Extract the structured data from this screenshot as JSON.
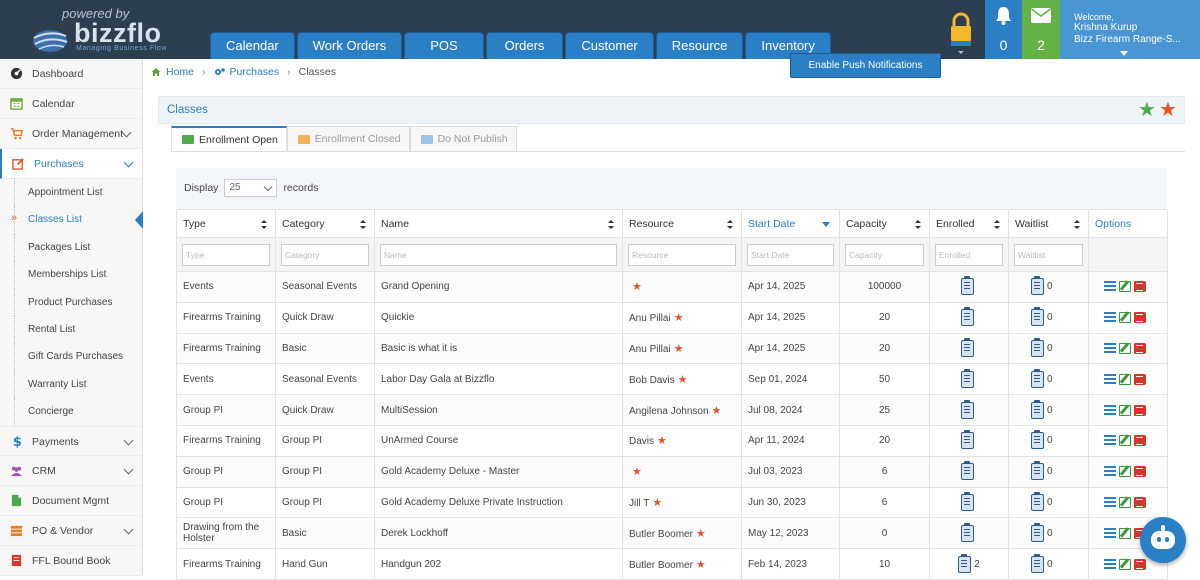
{
  "brand": {
    "powered_by": "powered by",
    "name": "bizzflo",
    "tagline": "Managing Business Flow"
  },
  "nav": [
    "Calendar",
    "Work Orders",
    "POS",
    "Orders",
    "Customer",
    "Resource",
    "Inventory"
  ],
  "header": {
    "bell_count": "0",
    "mail_count": "2",
    "welcome": "Welcome,",
    "user_name": "Krishna Kurup",
    "store": "Bizz Firearm Range-S..."
  },
  "push_button": "Enable Push Notifications",
  "sidebar": {
    "items": [
      {
        "label": "Dashboard",
        "icon": "dashboard-icon"
      },
      {
        "label": "Calendar",
        "icon": "calendar-icon"
      },
      {
        "label": "Order Management",
        "icon": "cart-icon"
      },
      {
        "label": "Purchases",
        "icon": "edit-icon"
      }
    ],
    "sub_items": [
      "Appointment List",
      "Classes List",
      "Packages List",
      "Memberships List",
      "Product Purchases",
      "Rental List",
      "Gift Cards Purchases",
      "Warranty List",
      "Concierge"
    ],
    "lower_items": [
      {
        "label": "Payments",
        "icon": "dollar-icon"
      },
      {
        "label": "CRM",
        "icon": "users-icon"
      },
      {
        "label": "Document Mgmt",
        "icon": "document-icon"
      },
      {
        "label": "PO & Vendor",
        "icon": "vendor-icon"
      },
      {
        "label": "FFL Bound Book",
        "icon": "book-icon"
      }
    ]
  },
  "breadcrumb": {
    "home": "Home",
    "purchases": "Purchases",
    "current": "Classes"
  },
  "page_title": "Classes",
  "tabs": [
    "Enrollment Open",
    "Enrollment Closed",
    "Do Not Publish"
  ],
  "display": {
    "label": "Display",
    "value": "25",
    "suffix": "records"
  },
  "columns": [
    "Type",
    "Category",
    "Name",
    "Resource",
    "Start Date",
    "Capacity",
    "Enrolled",
    "Waitlist",
    "Options"
  ],
  "filters": [
    "Type",
    "Category",
    "Name",
    "Resource",
    "Start Date",
    "Capacity",
    "Enrolled",
    "Waitlist"
  ],
  "rows": [
    {
      "type": "Events",
      "category": "Seasonal Events",
      "name": "Grand Opening",
      "resource": "",
      "start": "Apr 14, 2025",
      "capacity": "100000",
      "enrolled": "",
      "waitlist": "0"
    },
    {
      "type": "Firearms Training",
      "category": "Quick Draw",
      "name": "Quickie",
      "resource": "Anu Pillai",
      "start": "Apr 14, 2025",
      "capacity": "20",
      "enrolled": "",
      "waitlist": "0"
    },
    {
      "type": "Firearms Training",
      "category": "Basic",
      "name": "Basic is what it is",
      "resource": "Anu Pillai",
      "start": "Apr 14, 2025",
      "capacity": "20",
      "enrolled": "",
      "waitlist": "0"
    },
    {
      "type": "Events",
      "category": "Seasonal Events",
      "name": "Labor Day Gala at Bizzflo",
      "resource": "Bob Davis",
      "start": "Sep 01, 2024",
      "capacity": "50",
      "enrolled": "",
      "waitlist": "0"
    },
    {
      "type": "Group PI",
      "category": "Quick Draw",
      "name": "MultiSession",
      "resource": "Angilena Johnson",
      "start": "Jul 08, 2024",
      "capacity": "25",
      "enrolled": "",
      "waitlist": "0"
    },
    {
      "type": "Firearms Training",
      "category": "Group PI",
      "name": "UnArmed Course",
      "resource": "Davis",
      "start": "Apr 11, 2024",
      "capacity": "20",
      "enrolled": "",
      "waitlist": "0"
    },
    {
      "type": "Group PI",
      "category": "Group PI",
      "name": "Gold Academy Deluxe - Master",
      "resource": "",
      "start": "Jul 03, 2023",
      "capacity": "6",
      "enrolled": "",
      "waitlist": "0"
    },
    {
      "type": "Group PI",
      "category": "Group PI",
      "name": "Gold Academy Deluxe Private Instruction",
      "resource": "Jill T",
      "start": "Jun 30, 2023",
      "capacity": "6",
      "enrolled": "",
      "waitlist": "0"
    },
    {
      "type": "Drawing from the Holster",
      "category": "Basic",
      "name": "Derek Lockhoff",
      "resource": "Butler Boomer",
      "start": "May 12, 2023",
      "capacity": "0",
      "enrolled": "",
      "waitlist": "0"
    },
    {
      "type": "Firearms Training",
      "category": "Hand Gun",
      "name": "Handgun 202",
      "resource": "Butler Boomer",
      "start": "Feb 14, 2023",
      "capacity": "10",
      "enrolled": "2",
      "waitlist": "0"
    }
  ]
}
